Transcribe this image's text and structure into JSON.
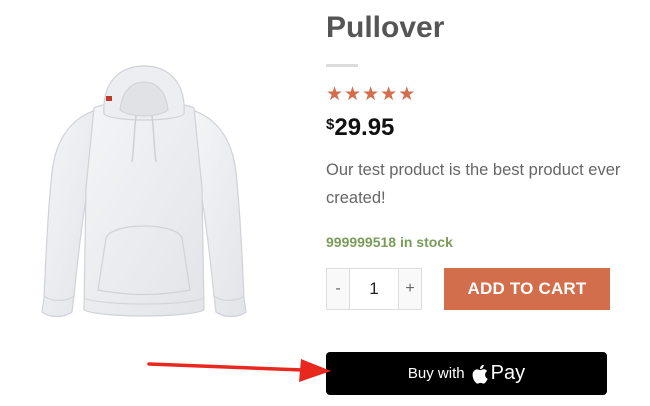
{
  "product": {
    "title": "Pullover",
    "rating": {
      "value": 5,
      "max": 5,
      "star_glyph": "★"
    },
    "price": {
      "currency": "$",
      "amount": "29.95"
    },
    "description": "Our test product is the best product ever created!",
    "stock": "999999518 in stock",
    "image_icon": "hoodie-image"
  },
  "cart": {
    "minus_label": "-",
    "quantity": "1",
    "plus_label": "+",
    "add_to_cart_label": "ADD TO CART"
  },
  "apple_pay": {
    "buy_label": "Buy with",
    "pay_label": "Pay",
    "logo_icon": "apple-logo-icon"
  },
  "annotation": {
    "arrow_icon": "red-arrow-icon",
    "color": "#e8281e"
  },
  "colors": {
    "accent": "#d26e4b",
    "stock_green": "#7a9c59",
    "apple_pay_bg": "#000000"
  }
}
